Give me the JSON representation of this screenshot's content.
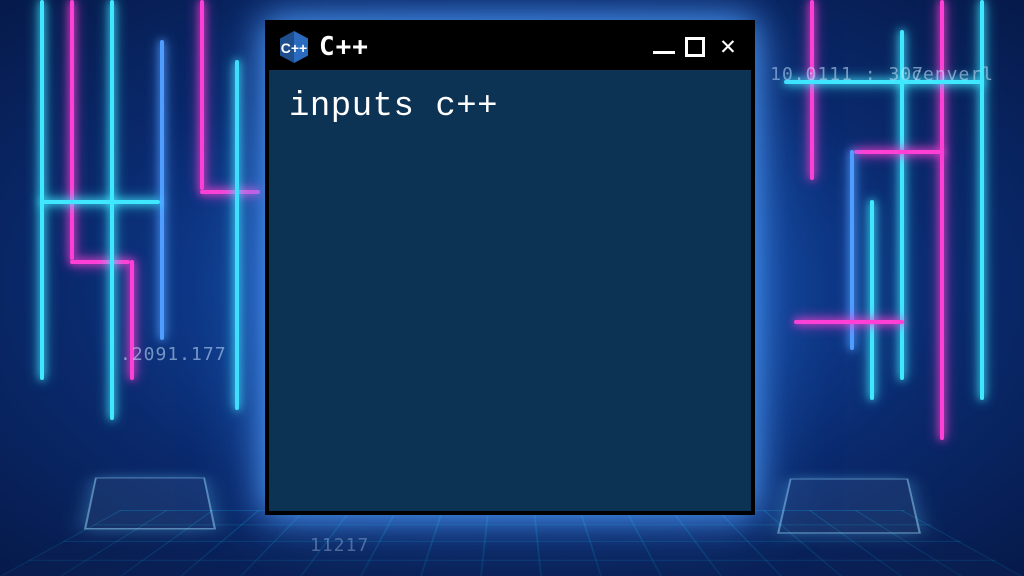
{
  "window": {
    "title": "C++",
    "icon_label": "C++"
  },
  "content": {
    "text": "inputs c++"
  },
  "background": {
    "left_text": ".2091.177",
    "right_text1": "10.0111 : 307",
    "right_text2": "cenverl",
    "bottom_text": "11217"
  }
}
